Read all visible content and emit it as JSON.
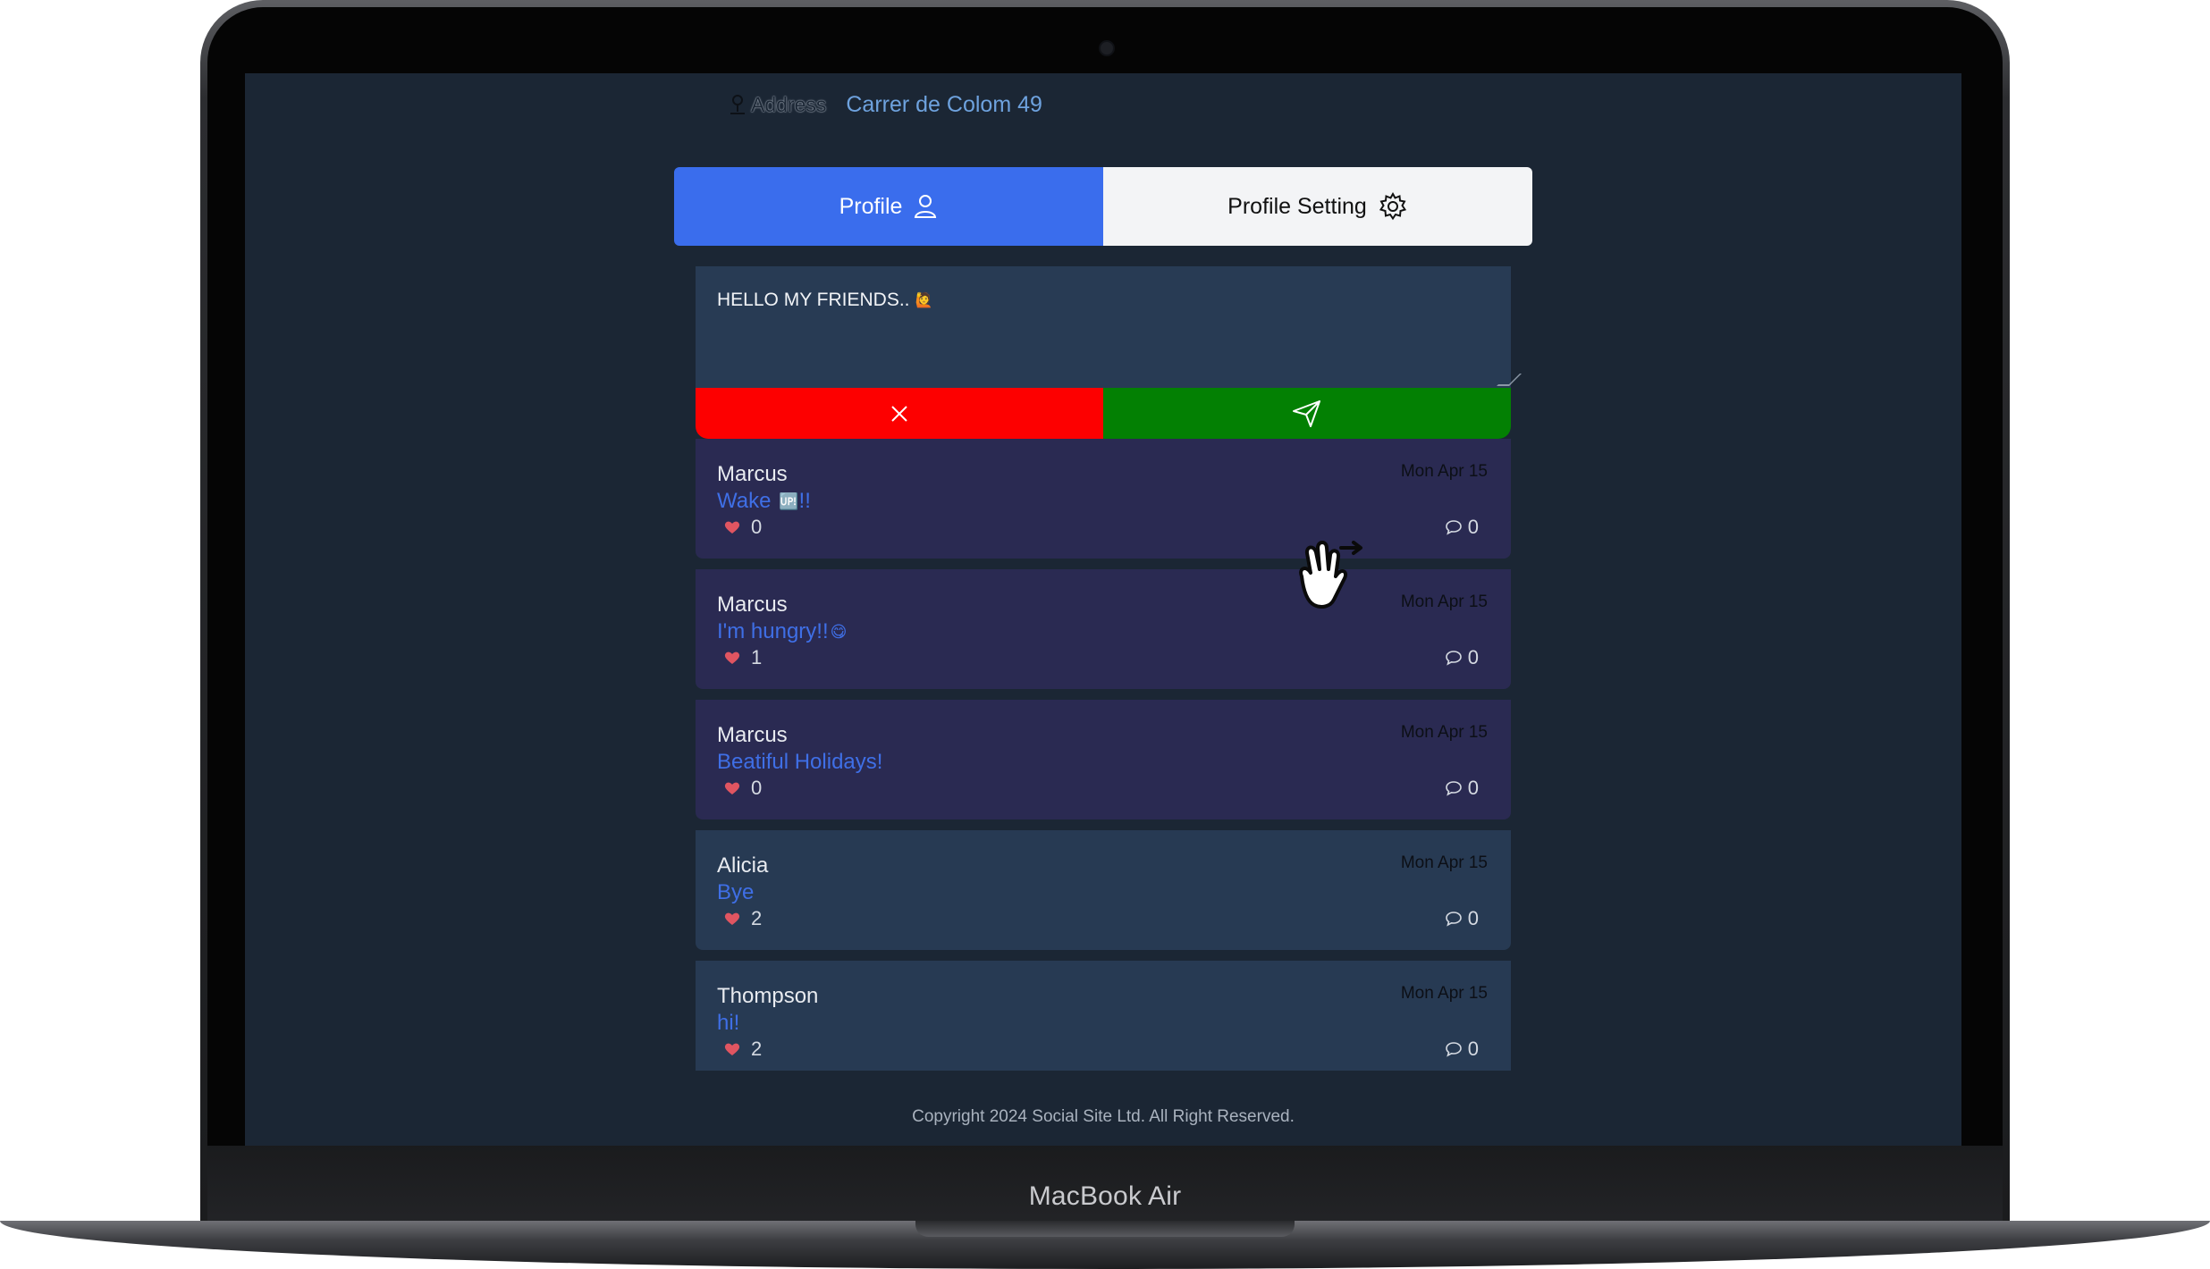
{
  "device": {
    "brand": "MacBook Air"
  },
  "colors": {
    "page_bg": "#1b2634",
    "accent_blue": "#3a6ded",
    "cancel_red": "#fd0000",
    "send_green": "#038003",
    "post_dark": "#2a2a52",
    "post_light": "#273a53"
  },
  "header": {
    "address_label": "Address",
    "address_value": "Carrer de Colom 49",
    "icon": "map-pin-icon"
  },
  "tabs": [
    {
      "label": "Profile",
      "icon": "user-icon",
      "active": true
    },
    {
      "label": "Profile Setting",
      "icon": "gear-icon",
      "active": false
    }
  ],
  "composer": {
    "value": "HELLO MY FRIENDS..",
    "emoji": "🙋",
    "cancel_icon": "close-icon",
    "send_icon": "send-icon"
  },
  "posts": [
    {
      "author": "Marcus",
      "text": "Wake ",
      "emoji": "🆙",
      "text_after": "!!",
      "date": "Mon Apr 15",
      "likes": "0",
      "comments": "0",
      "style": "dark"
    },
    {
      "author": "Marcus",
      "text": "I'm hungry!!",
      "emoji": "😋",
      "text_after": "",
      "date": "Mon Apr 15",
      "likes": "1",
      "comments": "0",
      "style": "dark"
    },
    {
      "author": "Marcus",
      "text": "Beatiful Holidays!",
      "emoji": "",
      "text_after": "",
      "date": "Mon Apr 15",
      "likes": "0",
      "comments": "0",
      "style": "dark"
    },
    {
      "author": "Alicia",
      "text": "Bye",
      "emoji": "",
      "text_after": "",
      "date": "Mon Apr 15",
      "likes": "2",
      "comments": "0",
      "style": "light"
    },
    {
      "author": "Thompson",
      "text": "hi!",
      "emoji": "",
      "text_after": "",
      "date": "Mon Apr 15",
      "likes": "2",
      "comments": "0",
      "style": "light"
    }
  ],
  "footer": {
    "copyright": "Copyright 2024 Social Site Ltd. All Right Reserved."
  }
}
